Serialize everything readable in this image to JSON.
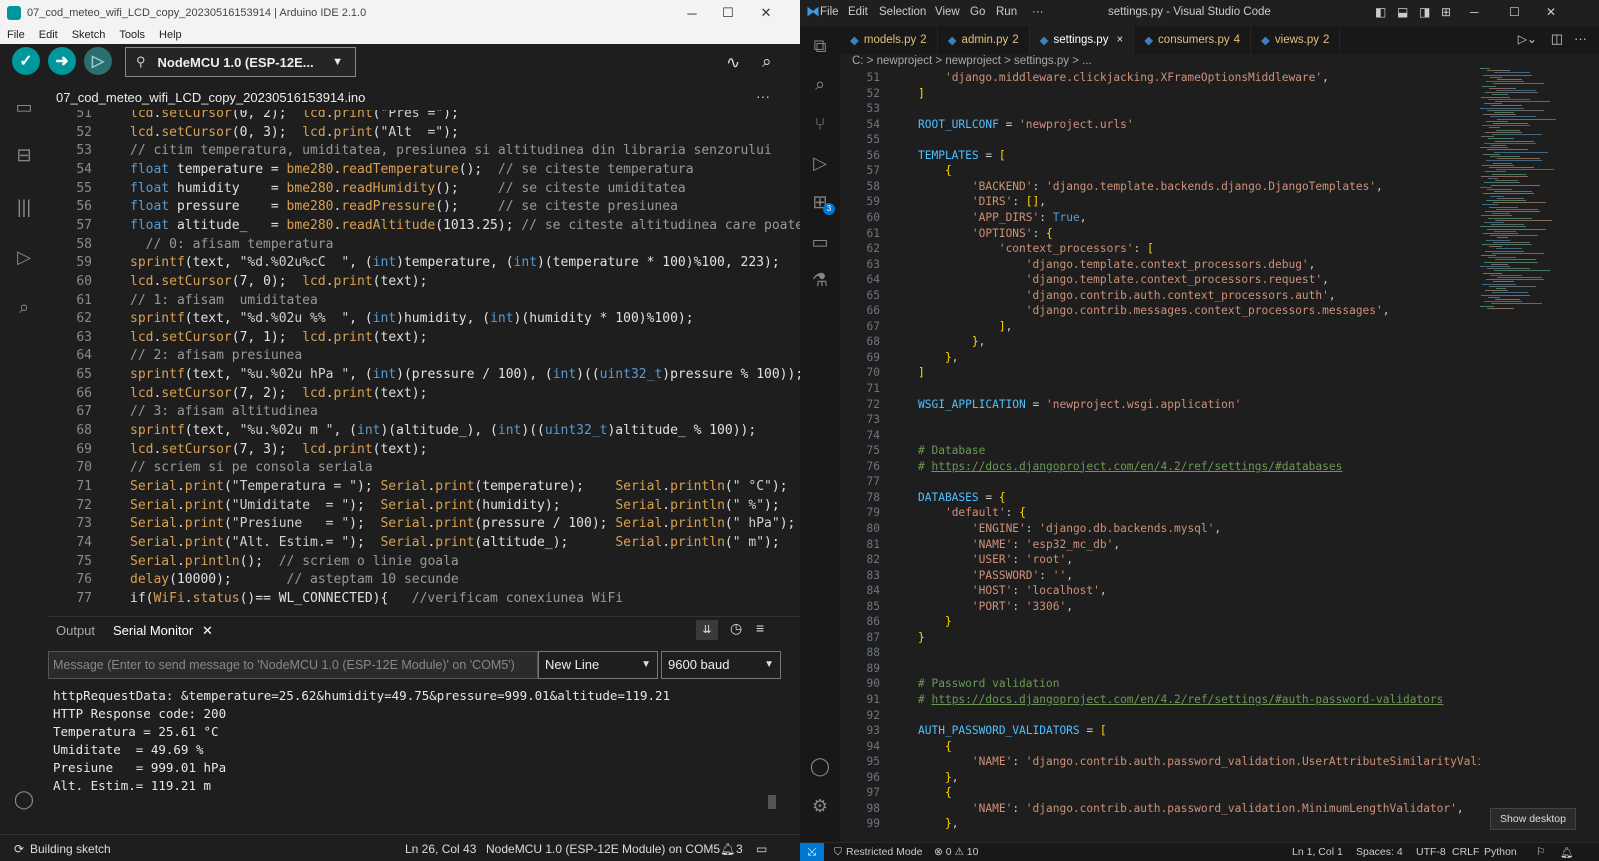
{
  "arduino": {
    "title": "07_cod_meteo_wifi_LCD_copy_20230516153914 | Arduino IDE 2.1.0",
    "menu": [
      "File",
      "Edit",
      "Sketch",
      "Tools",
      "Help"
    ],
    "board": "NodeMCU 1.0 (ESP-12E...",
    "file_tab": "07_cod_meteo_wifi_LCD_copy_20230516153914.ino",
    "code": [
      {
        "n": "51",
        "t": "lcd.setCursor(0, 2);  lcd.print(\"Pres =\");"
      },
      {
        "n": "52",
        "t": "lcd.setCursor(0, 3);  lcd.print(\"Alt  =\");"
      },
      {
        "n": "53",
        "t": "// citim temperatura, umiditatea, presiunea si altitudinea din libraria senzorului"
      },
      {
        "n": "54",
        "t": "float temperature = bme280.readTemperature();  // se citeste temperatura"
      },
      {
        "n": "55",
        "t": "float humidity    = bme280.readHumidity();     // se citeste umiditatea"
      },
      {
        "n": "56",
        "t": "float pressure    = bme280.readPressure();     // se citeste presiunea"
      },
      {
        "n": "57",
        "t": "float altitude_   = bme280.readAltitude(1013.25); // se citeste altitudinea care poate"
      },
      {
        "n": "58",
        "t": "  // 0: afisam temperatura"
      },
      {
        "n": "59",
        "t": "sprintf(text, \"%d.%02u%cC  \", (int)temperature, (int)(temperature * 100)%100, 223);"
      },
      {
        "n": "60",
        "t": "lcd.setCursor(7, 0);  lcd.print(text);"
      },
      {
        "n": "61",
        "t": "// 1: afisam  umiditatea"
      },
      {
        "n": "62",
        "t": "sprintf(text, \"%d.%02u %%  \", (int)humidity, (int)(humidity * 100)%100);"
      },
      {
        "n": "63",
        "t": "lcd.setCursor(7, 1);  lcd.print(text);"
      },
      {
        "n": "64",
        "t": "// 2: afisam presiunea"
      },
      {
        "n": "65",
        "t": "sprintf(text, \"%u.%02u hPa \", (int)(pressure / 100), (int)((uint32_t)pressure % 100));"
      },
      {
        "n": "66",
        "t": "lcd.setCursor(7, 2);  lcd.print(text);"
      },
      {
        "n": "67",
        "t": "// 3: afisam altitudinea"
      },
      {
        "n": "68",
        "t": "sprintf(text, \"%u.%02u m \", (int)(altitude_), (int)((uint32_t)altitude_ % 100));"
      },
      {
        "n": "69",
        "t": "lcd.setCursor(7, 3);  lcd.print(text);"
      },
      {
        "n": "70",
        "t": "// scriem si pe consola seriala"
      },
      {
        "n": "71",
        "t": "Serial.print(\"Temperatura = \"); Serial.print(temperature);    Serial.println(\" °C\");"
      },
      {
        "n": "72",
        "t": "Serial.print(\"Umiditate  = \");  Serial.print(humidity);       Serial.println(\" %\");"
      },
      {
        "n": "73",
        "t": "Serial.print(\"Presiune   = \");  Serial.print(pressure / 100); Serial.println(\" hPa\");"
      },
      {
        "n": "74",
        "t": "Serial.print(\"Alt. Estim.= \");  Serial.print(altitude_);      Serial.println(\" m\");"
      },
      {
        "n": "75",
        "t": "Serial.println();  // scriem o linie goala"
      },
      {
        "n": "76",
        "t": "delay(10000);       // asteptam 10 secunde"
      },
      {
        "n": "77",
        "t": "if(WiFi.status()== WL_CONNECTED){   //verificam conexiunea WiFi"
      }
    ],
    "panel_tabs": [
      "Output",
      "Serial Monitor"
    ],
    "message_placeholder": "Message (Enter to send message to 'NodeMCU 1.0 (ESP-12E Module)' on 'COM5')",
    "line_ending": "New Line",
    "baud": "9600 baud",
    "serial_output": [
      "httpRequestData: &temperature=25.62&humidity=49.75&pressure=999.01&altitude=119.21",
      "HTTP Response code: 200",
      "Temperatura = 25.61 °C",
      "Umiditate  = 49.69 %",
      "Presiune   = 999.01 hPa",
      "Alt. Estim.= 119.21 m"
    ],
    "status": {
      "building": "Building sketch",
      "position": "Ln 26, Col 43",
      "board_port": "NodeMCU 1.0 (ESP-12E Module) on COM5",
      "notifications": "3"
    }
  },
  "vscode": {
    "menu": [
      "File",
      "Edit",
      "Selection",
      "View",
      "Go",
      "Run",
      "···"
    ],
    "title": "settings.py - Visual Studio Code",
    "tabs": [
      {
        "name": "models.py",
        "badge": "2"
      },
      {
        "name": "admin.py",
        "badge": "2"
      },
      {
        "name": "settings.py",
        "badge": "×"
      },
      {
        "name": "consumers.py",
        "badge": "4"
      },
      {
        "name": "views.py",
        "badge": "2"
      }
    ],
    "breadcrumb": "C: > newproject > newproject > settings.py > ...",
    "code": [
      {
        "n": "51",
        "t": "    'django.middleware.clickjacking.XFrameOptionsMiddleware',"
      },
      {
        "n": "52",
        "t": "]"
      },
      {
        "n": "53",
        "t": ""
      },
      {
        "n": "54",
        "t": "ROOT_URLCONF = 'newproject.urls'"
      },
      {
        "n": "55",
        "t": ""
      },
      {
        "n": "56",
        "t": "TEMPLATES = ["
      },
      {
        "n": "57",
        "t": "    {"
      },
      {
        "n": "58",
        "t": "        'BACKEND': 'django.template.backends.django.DjangoTemplates',"
      },
      {
        "n": "59",
        "t": "        'DIRS': [],"
      },
      {
        "n": "60",
        "t": "        'APP_DIRS': True,"
      },
      {
        "n": "61",
        "t": "        'OPTIONS': {"
      },
      {
        "n": "62",
        "t": "            'context_processors': ["
      },
      {
        "n": "63",
        "t": "                'django.template.context_processors.debug',"
      },
      {
        "n": "64",
        "t": "                'django.template.context_processors.request',"
      },
      {
        "n": "65",
        "t": "                'django.contrib.auth.context_processors.auth',"
      },
      {
        "n": "66",
        "t": "                'django.contrib.messages.context_processors.messages',"
      },
      {
        "n": "67",
        "t": "            ],"
      },
      {
        "n": "68",
        "t": "        },"
      },
      {
        "n": "69",
        "t": "    },"
      },
      {
        "n": "70",
        "t": "]"
      },
      {
        "n": "71",
        "t": ""
      },
      {
        "n": "72",
        "t": "WSGI_APPLICATION = 'newproject.wsgi.application'"
      },
      {
        "n": "73",
        "t": ""
      },
      {
        "n": "74",
        "t": ""
      },
      {
        "n": "75",
        "t": "# Database"
      },
      {
        "n": "76",
        "t": "# https://docs.djangoproject.com/en/4.2/ref/settings/#databases"
      },
      {
        "n": "77",
        "t": ""
      },
      {
        "n": "78",
        "t": "DATABASES = {"
      },
      {
        "n": "79",
        "t": "    'default': {"
      },
      {
        "n": "80",
        "t": "        'ENGINE': 'django.db.backends.mysql',"
      },
      {
        "n": "81",
        "t": "        'NAME': 'esp32_mc_db',"
      },
      {
        "n": "82",
        "t": "        'USER': 'root',"
      },
      {
        "n": "83",
        "t": "        'PASSWORD': '',"
      },
      {
        "n": "84",
        "t": "        'HOST': 'localhost',"
      },
      {
        "n": "85",
        "t": "        'PORT': '3306',"
      },
      {
        "n": "86",
        "t": "    }"
      },
      {
        "n": "87",
        "t": "}"
      },
      {
        "n": "88",
        "t": ""
      },
      {
        "n": "89",
        "t": ""
      },
      {
        "n": "90",
        "t": "# Password validation"
      },
      {
        "n": "91",
        "t": "# https://docs.djangoproject.com/en/4.2/ref/settings/#auth-password-validators"
      },
      {
        "n": "92",
        "t": ""
      },
      {
        "n": "93",
        "t": "AUTH_PASSWORD_VALIDATORS = ["
      },
      {
        "n": "94",
        "t": "    {"
      },
      {
        "n": "95",
        "t": "        'NAME': 'django.contrib.auth.password_validation.UserAttributeSimilarityValidator',"
      },
      {
        "n": "96",
        "t": "    },"
      },
      {
        "n": "97",
        "t": "    {"
      },
      {
        "n": "98",
        "t": "        'NAME': 'django.contrib.auth.password_validation.MinimumLengthValidator',"
      },
      {
        "n": "99",
        "t": "    },"
      }
    ],
    "status": {
      "mode": "Restricted Mode",
      "problems": "⊗ 0 ⚠ 10",
      "position": "Ln 1, Col 1",
      "spaces": "Spaces: 4",
      "encoding": "UTF-8",
      "eol": "CRLF",
      "language": "Python"
    },
    "extensions_badge": "3",
    "show_desktop": "Show desktop"
  }
}
